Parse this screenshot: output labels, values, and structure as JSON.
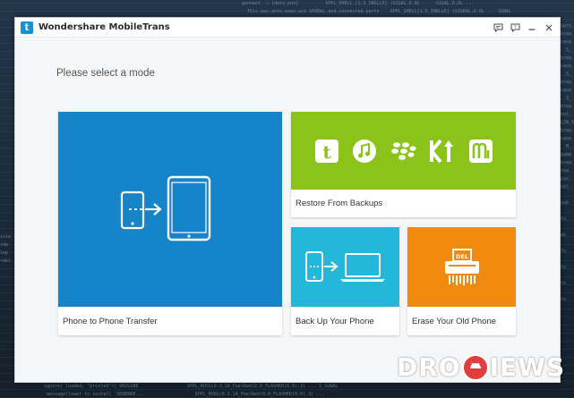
{
  "window": {
    "title": "Wondershare MobileTrans",
    "logo_letter": "t"
  },
  "content": {
    "prompt": "Please select a mode"
  },
  "tiles": {
    "phone_to_phone": {
      "label": "Phone to Phone Transfer",
      "color": "#1684c9"
    },
    "restore": {
      "label": "Restore From Backups",
      "color": "#8bc31b"
    },
    "backup": {
      "label": "Back Up Your Phone",
      "color": "#23b7d9"
    },
    "erase": {
      "label": "Erase Your Old Phone",
      "color": "#f18a0f",
      "shredder_text": "DEL"
    }
  },
  "restore_services": [
    "mobiletrans-icon",
    "itunes-icon",
    "blackberry-icon",
    "kies-icon",
    "mobilego-icon"
  ],
  "watermark": {
    "left": "DRO",
    "right": "IEWS"
  }
}
